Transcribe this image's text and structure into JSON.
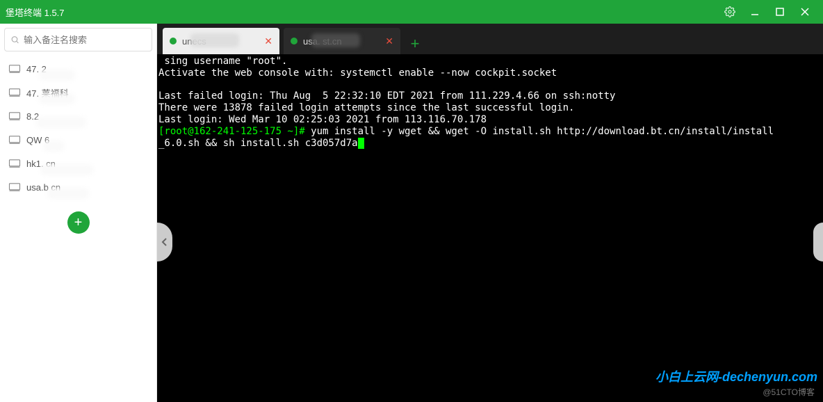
{
  "titlebar": {
    "title": "堡塔终端  1.5.7"
  },
  "search": {
    "placeholder": "输入备注名搜索"
  },
  "sidebar": {
    "items": [
      {
        "label": "47.            2"
      },
      {
        "label": "47.          莱福科"
      },
      {
        "label": "8.2"
      },
      {
        "label": "QW      6"
      },
      {
        "label": "hk1.              cn"
      },
      {
        "label": "usa.b            cn"
      }
    ]
  },
  "tabs": [
    {
      "label": "              unecs",
      "active": false
    },
    {
      "label": "usa.            st.cn",
      "active": true
    }
  ],
  "terminal": {
    "lines": [
      " sing username \"root\".",
      "Activate the web console with: systemctl enable --now cockpit.socket",
      "",
      "Last failed login: Thu Aug  5 22:32:10 EDT 2021 from 111.229.4.66 on ssh:notty",
      "There were 13878 failed login attempts since the last successful login.",
      "Last login: Wed Mar 10 02:25:03 2021 from 113.116.70.178"
    ],
    "prompt": "[root@162-241-125-175 ~]#",
    "command": " yum install -y wget && wget -O install.sh http://download.bt.cn/install/install\n_6.0.sh && sh install.sh c3d057d7a"
  },
  "watermark": {
    "main": "小白上云网-dechenyun.com",
    "cto": "@51CTO博客"
  }
}
